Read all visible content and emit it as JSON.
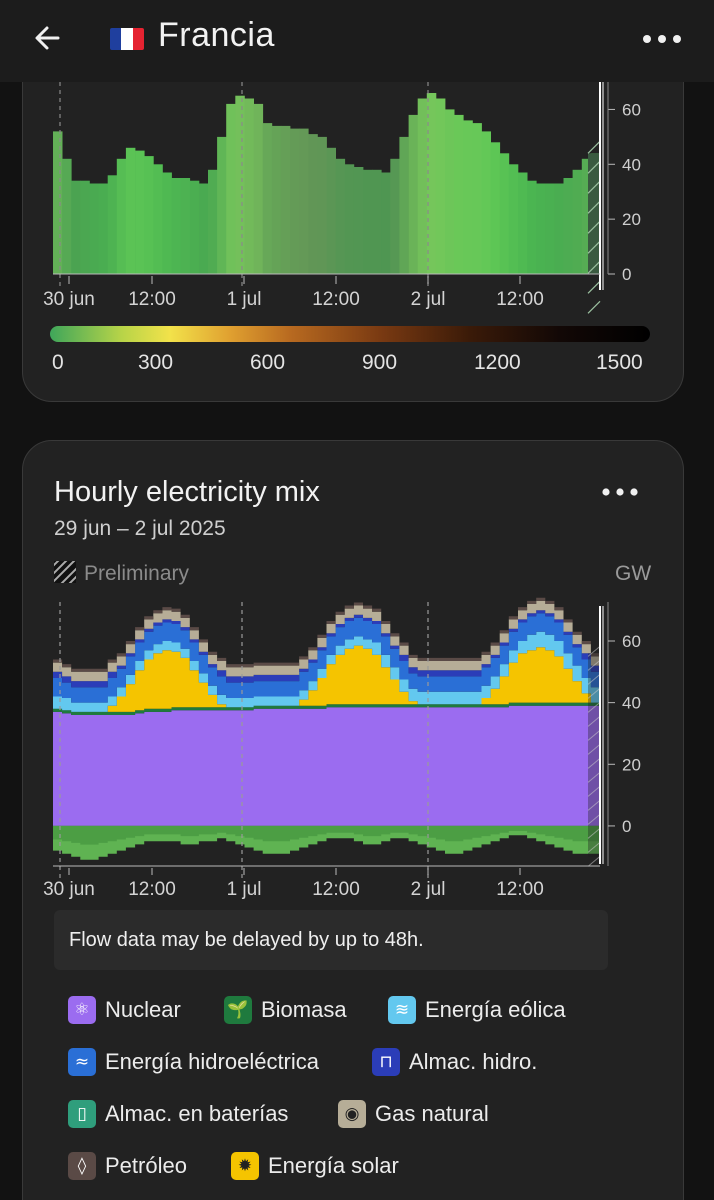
{
  "header": {
    "title": "Francia",
    "flag_colors": [
      "#1f3f9e",
      "#ffffff",
      "#e52331"
    ]
  },
  "card_carbon": {
    "x_ticks": [
      "30 jun",
      "12:00",
      "1 jul",
      "12:00",
      "2 jul",
      "12:00"
    ],
    "y_ticks": [
      "60",
      "40",
      "20",
      "0"
    ],
    "colorbar_labels": [
      "0",
      "300",
      "600",
      "900",
      "1200",
      "1500"
    ]
  },
  "card_mix": {
    "title": "Hourly electricity mix",
    "subtitle": "29 jun – 2 jul 2025",
    "preliminary_label": "Preliminary",
    "unit": "GW",
    "x_ticks": [
      "30 jun",
      "12:00",
      "1 jul",
      "12:00",
      "2 jul",
      "12:00"
    ],
    "y_ticks": [
      "60",
      "40",
      "20",
      "0"
    ],
    "notice": "Flow data may be delayed by up to 48h.",
    "legend": [
      {
        "label": "Nuclear",
        "icon": "atom-icon",
        "color": "#9b6cf0"
      },
      {
        "label": "Biomasa",
        "icon": "sprout-icon",
        "color": "#1f7a3e"
      },
      {
        "label": "Energía eólica",
        "icon": "wind-icon",
        "color": "#63c8ef"
      },
      {
        "label": "Energía hidroeléctrica",
        "icon": "waves-icon",
        "color": "#2a6fd6"
      },
      {
        "label": "Almac. hidro.",
        "icon": "battery-storage-icon",
        "color": "#2b3db8"
      },
      {
        "label": "Almac. en baterías",
        "icon": "battery-icon",
        "color": "#2f9e7c"
      },
      {
        "label": "Gas natural",
        "icon": "flame-icon",
        "color": "#b6ad97"
      },
      {
        "label": "Petróleo",
        "icon": "droplet-icon",
        "color": "#5a4a46"
      },
      {
        "label": "Energía solar",
        "icon": "sun-icon",
        "color": "#f5c400"
      }
    ]
  },
  "chart_data": [
    {
      "type": "bar",
      "note": "carbon intensity top chart (total load, GW), hourly",
      "y_range": [
        0,
        70
      ],
      "values": [
        52,
        42,
        34,
        34,
        33,
        33,
        36,
        42,
        46,
        45,
        43,
        40,
        37,
        35,
        35,
        34,
        33,
        38,
        50,
        62,
        65,
        64,
        62,
        55,
        54,
        54,
        53,
        53,
        51,
        50,
        46,
        42,
        40,
        39,
        38,
        38,
        37,
        42,
        50,
        58,
        64,
        66,
        64,
        60,
        58,
        56,
        55,
        52,
        48,
        44,
        40,
        37,
        34,
        33,
        33,
        33,
        35,
        38,
        42,
        44
      ]
    },
    {
      "type": "area",
      "title": "Hourly electricity mix",
      "y_range": [
        -13,
        72
      ],
      "unit": "GW",
      "series": [
        {
          "name": "Nuclear",
          "values": [
            37,
            36.5,
            36,
            36,
            36,
            36,
            36,
            36,
            36,
            36.5,
            37,
            37,
            37,
            37.5,
            37.5,
            37.5,
            37.5,
            37.5,
            37.5,
            37.5,
            37.5,
            37.5,
            38,
            38,
            38,
            38,
            38,
            38,
            38,
            38,
            38.5,
            38.5,
            38.5,
            38.5,
            38.5,
            38.5,
            38.5,
            38.5,
            38.5,
            38.5,
            38.5,
            38.5,
            38.5,
            38.5,
            38.5,
            38.5,
            38.5,
            38.5,
            38.5,
            38.5,
            39,
            39,
            39,
            39,
            39,
            39,
            39,
            39,
            39,
            39
          ]
        },
        {
          "name": "Biomasa",
          "values": [
            1,
            1,
            1,
            1,
            1,
            1,
            1,
            1,
            1,
            1,
            1,
            1,
            1,
            1,
            1,
            1,
            1,
            1,
            1,
            1,
            1,
            1,
            1,
            1,
            1,
            1,
            1,
            1,
            1,
            1,
            1,
            1,
            1,
            1,
            1,
            1,
            1,
            1,
            1,
            1,
            1,
            1,
            1,
            1,
            1,
            1,
            1,
            1,
            1,
            1,
            1,
            1,
            1,
            1,
            1,
            1,
            1,
            1,
            1,
            1
          ]
        },
        {
          "name": "Energía solar",
          "values": [
            0,
            0,
            0,
            0,
            0,
            0,
            2,
            5,
            9,
            13,
            16,
            18,
            19,
            18,
            16,
            12,
            8,
            4,
            1,
            0,
            0,
            0,
            0,
            0,
            0,
            0,
            0,
            2,
            5,
            9,
            13,
            16,
            18,
            19,
            18,
            16,
            12,
            8,
            4,
            1,
            0,
            0,
            0,
            0,
            0,
            0,
            0,
            2,
            5,
            9,
            13,
            16,
            17,
            18,
            17,
            15,
            11,
            7,
            3,
            0
          ]
        },
        {
          "name": "Energía eólica",
          "values": [
            4,
            4,
            3,
            3,
            3,
            3,
            3,
            3,
            3,
            3,
            3,
            3,
            3,
            3,
            3,
            3,
            3,
            3,
            3,
            3,
            3,
            3,
            3,
            3,
            3,
            3,
            3,
            3,
            3,
            3,
            3,
            3,
            3,
            3,
            3,
            4,
            4,
            4,
            4,
            4,
            4,
            4,
            4,
            4,
            4,
            4,
            4,
            4,
            4,
            4,
            4,
            4,
            5,
            5,
            5,
            5,
            5,
            5,
            5,
            5
          ]
        },
        {
          "name": "Energía hidroeléctrica",
          "values": [
            6,
            5,
            5,
            5,
            5,
            5,
            6,
            6,
            6,
            6,
            6,
            6,
            6,
            6,
            6,
            6,
            6,
            6,
            6,
            5,
            5,
            5,
            5,
            5,
            5,
            5,
            5,
            6,
            6,
            6,
            6,
            6,
            6,
            6,
            6,
            6,
            6,
            6,
            6,
            5,
            5,
            5,
            5,
            5,
            5,
            5,
            5,
            6,
            6,
            6,
            6,
            6,
            6,
            6,
            6,
            6,
            6,
            6,
            6,
            5
          ]
        },
        {
          "name": "Almac. hidro.",
          "values": [
            2,
            2,
            2,
            2,
            2,
            2,
            2,
            1,
            1,
            1,
            1,
            1,
            1,
            1,
            1,
            1,
            1,
            1,
            2,
            2,
            2,
            2,
            2,
            2,
            2,
            2,
            2,
            1,
            1,
            1,
            1,
            1,
            1,
            1,
            1,
            1,
            1,
            1,
            2,
            2,
            2,
            2,
            2,
            2,
            2,
            2,
            2,
            1,
            1,
            1,
            1,
            1,
            1,
            1,
            1,
            1,
            1,
            1,
            2,
            2
          ]
        },
        {
          "name": "Gas natural",
          "values": [
            3,
            3,
            3,
            3,
            3,
            3,
            3,
            3,
            3,
            3,
            3,
            3,
            3,
            3,
            3,
            3,
            3,
            3,
            3,
            3,
            3,
            3,
            3,
            3,
            3,
            3,
            3,
            3,
            3,
            3,
            3,
            3,
            3,
            3,
            3,
            3,
            3,
            3,
            3,
            3,
            3,
            3,
            3,
            3,
            3,
            3,
            3,
            3,
            3,
            3,
            3,
            3,
            3,
            3,
            3,
            3,
            3,
            3,
            3,
            3
          ]
        },
        {
          "name": "Petróleo",
          "values": [
            1,
            1,
            1,
            1,
            1,
            1,
            1,
            1,
            1,
            1,
            1,
            1,
            1,
            1,
            1,
            1,
            1,
            1,
            1,
            1,
            1,
            1,
            1,
            1,
            1,
            1,
            1,
            1,
            1,
            1,
            1,
            1,
            1,
            1,
            1,
            1,
            1,
            1,
            1,
            1,
            1,
            1,
            1,
            1,
            1,
            1,
            1,
            1,
            1,
            1,
            1,
            1,
            1,
            1,
            1,
            1,
            1,
            1,
            1,
            1
          ]
        }
      ],
      "exports": [
        -8,
        -9,
        -10,
        -11,
        -11,
        -10,
        -9,
        -8,
        -7,
        -6,
        -5,
        -5,
        -5,
        -5,
        -6,
        -6,
        -5,
        -5,
        -4,
        -5,
        -6,
        -7,
        -8,
        -9,
        -9,
        -9,
        -8,
        -7,
        -6,
        -5,
        -4,
        -4,
        -4,
        -5,
        -6,
        -6,
        -5,
        -4,
        -4,
        -5,
        -6,
        -7,
        -8,
        -9,
        -9,
        -8,
        -7,
        -6,
        -5,
        -4,
        -3,
        -3,
        -4,
        -5,
        -6,
        -7,
        -8,
        -9,
        -9,
        -9
      ]
    }
  ]
}
